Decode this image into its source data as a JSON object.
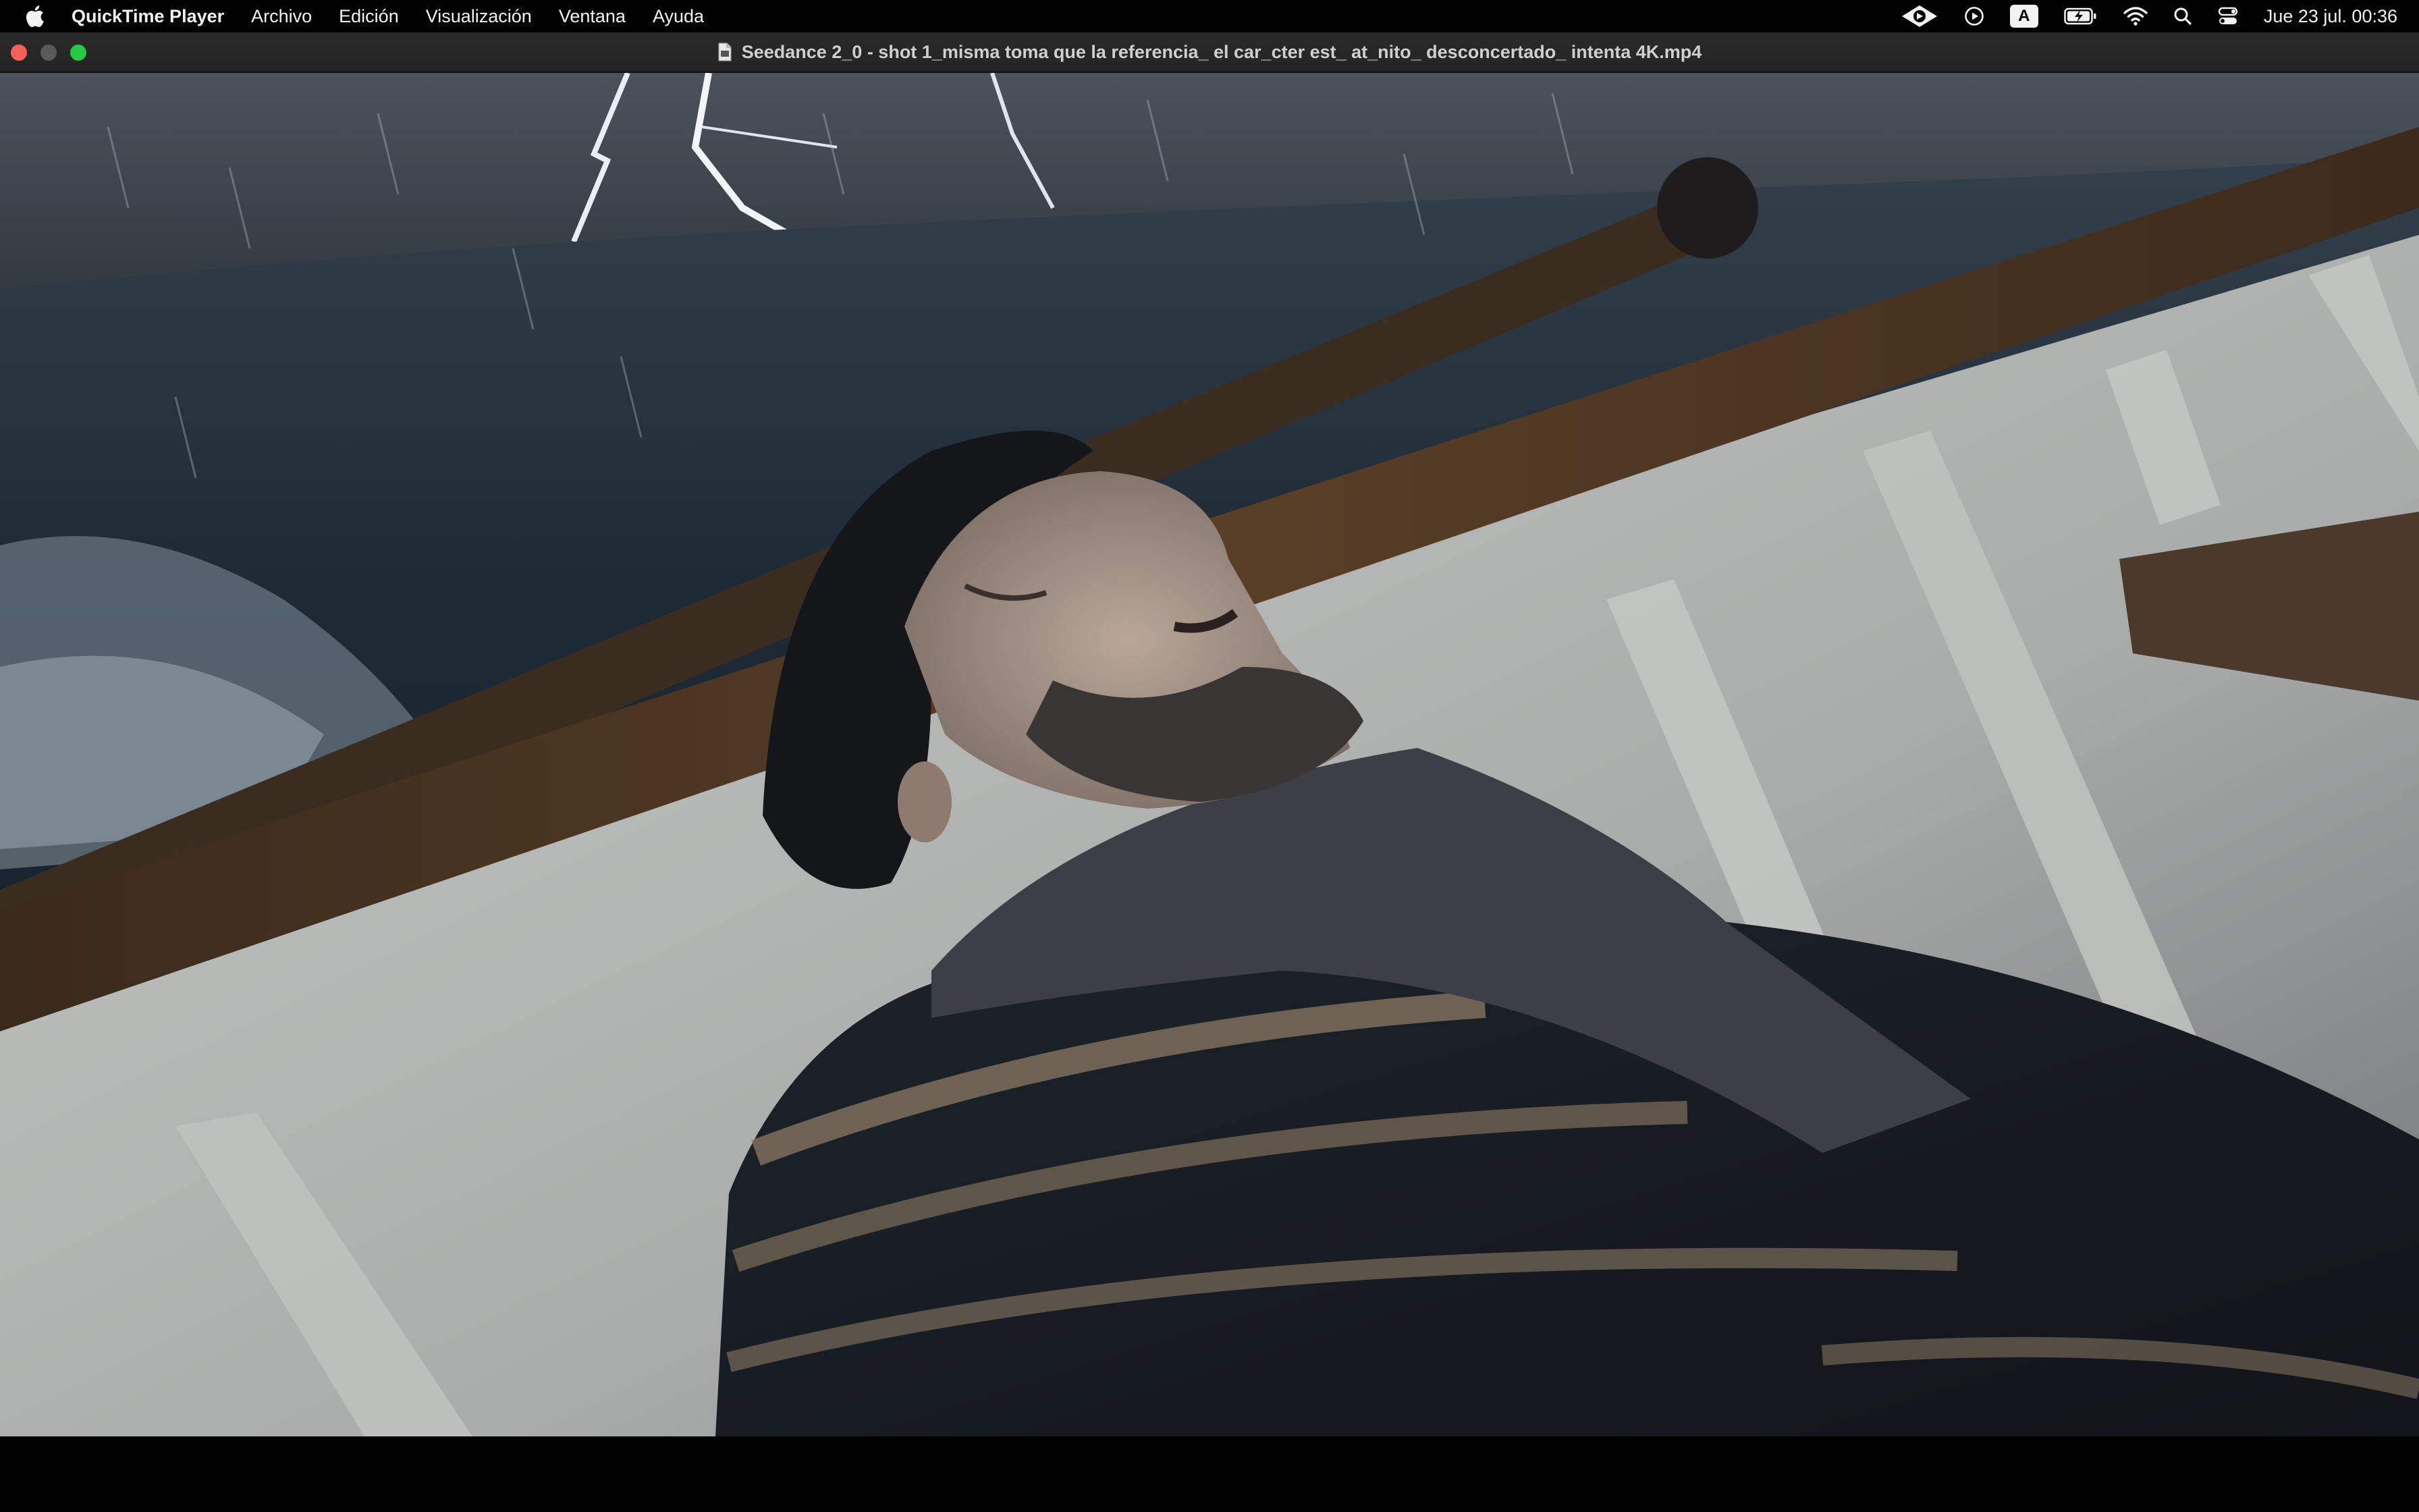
{
  "menubar": {
    "app_name": "QuickTime Player",
    "items": [
      "Archivo",
      "Edición",
      "Visualización",
      "Ventana",
      "Ayuda"
    ],
    "input_source": "A",
    "clock": "Jue 23 jul.  00:36"
  },
  "window": {
    "title": "Seedance 2_0 - shot 1_misma toma que la referencia_ el car_cter est_ at_nito_ desconcertado_ intenta 4K.mp4"
  },
  "colors": {
    "close": "#ff5f57",
    "minimize": "#595959",
    "zoom": "#28c840"
  }
}
